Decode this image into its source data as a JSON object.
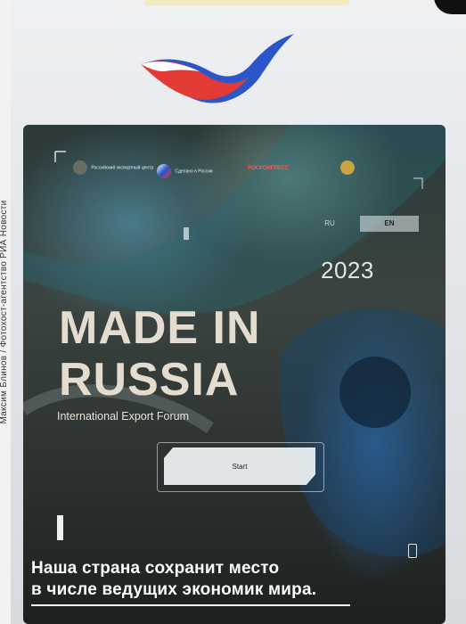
{
  "photo_credit": "Максим Блинов / Фотохост-агентство РИА Новости",
  "kiosk": {
    "brand_colors": {
      "white": "#ffffff",
      "blue": "#2b56c9",
      "red": "#e23a34"
    }
  },
  "screen": {
    "partner_logos": [
      {
        "name": "Российский экспортный центр",
        "icon": "rec-logo-icon"
      },
      {
        "name": "Сделано в России",
        "icon": "made-in-russia-logo-icon"
      },
      {
        "name": "РОСКОНГРЕСС",
        "icon": "roscongress-logo-icon"
      },
      {
        "name": "",
        "icon": "emblem-logo-icon"
      }
    ],
    "languages": {
      "ru": "RU",
      "en": "EN",
      "selected": "EN"
    },
    "year": "2023",
    "title_line1": "MADE IN",
    "title_line2": "RUSSIA",
    "subtitle": "International Export Forum",
    "start_label": "Start"
  },
  "caption": {
    "line1": "Наша страна сохранит место",
    "line2": "в числе ведущих экономик мира."
  }
}
